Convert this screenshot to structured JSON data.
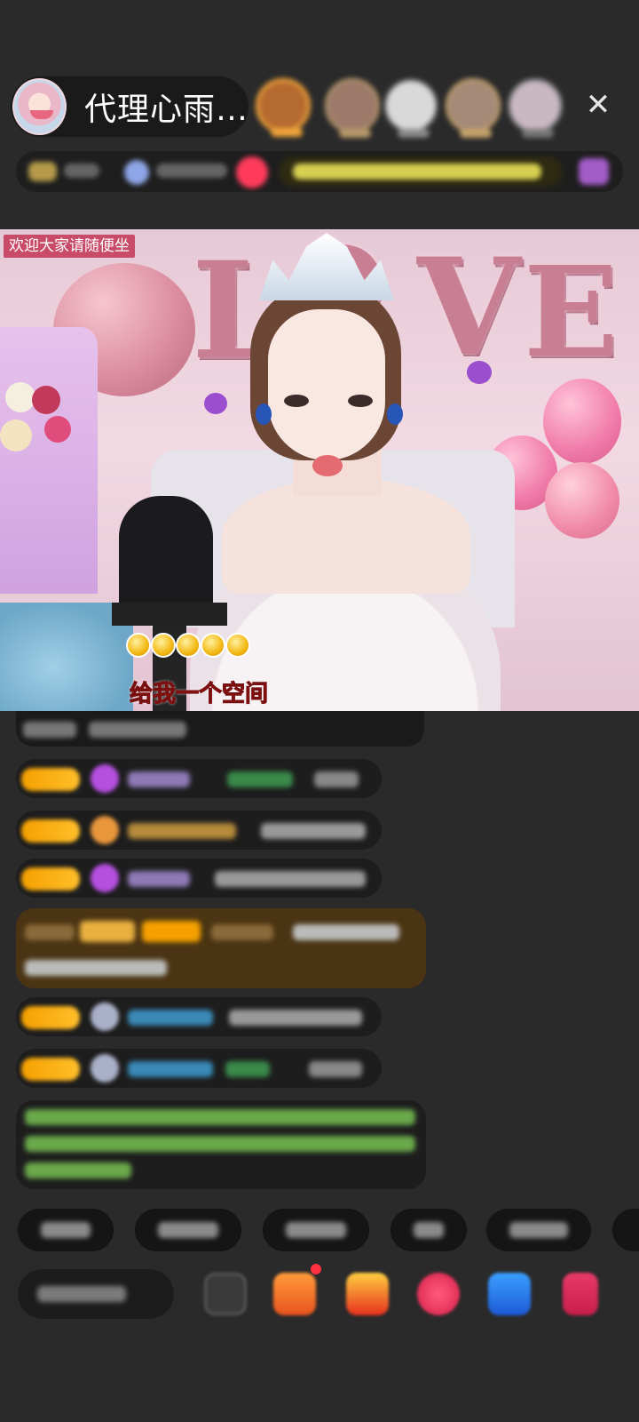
{
  "header": {
    "host_name": "代理心雨…",
    "close_icon": "close-icon"
  },
  "video": {
    "welcome_text": "欢迎大家请随便坐",
    "caption": "给我一个空间",
    "letters": [
      "L",
      "O",
      "V",
      "E"
    ]
  },
  "colors": {
    "background": "#2a2a2b",
    "welcome_bg": "#c94b6a",
    "caption_red": "#e0261f",
    "badge_gold": "#f5a000"
  }
}
